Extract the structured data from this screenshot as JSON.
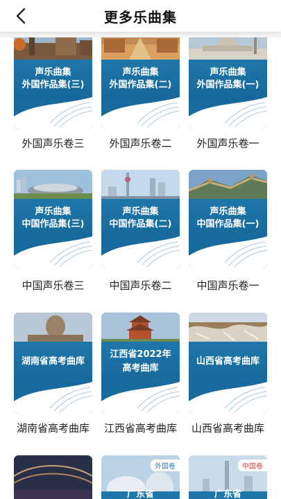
{
  "header": {
    "title": "更多乐曲集"
  },
  "cards": [
    {
      "cover_lines": [
        "声乐曲集",
        "外国作品集(三)"
      ],
      "label": "外国声乐卷三"
    },
    {
      "cover_lines": [
        "声乐曲集",
        "外国作品集(二)"
      ],
      "label": "外国声乐卷二"
    },
    {
      "cover_lines": [
        "声乐曲集",
        "外国作品集(一)"
      ],
      "label": "外国声乐卷一"
    },
    {
      "cover_lines": [
        "声乐曲集",
        "中国作品集(三)"
      ],
      "label": "中国声乐卷三"
    },
    {
      "cover_lines": [
        "声乐曲集",
        "中国作品集(二)"
      ],
      "label": "中国声乐卷二"
    },
    {
      "cover_lines": [
        "声乐曲集",
        "中国作品集(一)"
      ],
      "label": "中国声乐卷一"
    },
    {
      "cover_lines": [
        "湖南省高考曲库"
      ],
      "label": "湖南省高考曲库"
    },
    {
      "cover_lines": [
        "江西省2022年",
        "高考曲库"
      ],
      "label": "江西省高考曲库"
    },
    {
      "cover_lines": [
        "山西省高考曲库"
      ],
      "label": "山西省高考曲库"
    },
    {
      "cover_lines": [],
      "label": ""
    },
    {
      "cover_lines": [
        "广东省"
      ],
      "tag": "外国卷",
      "label": ""
    },
    {
      "cover_lines": [
        "广东省"
      ],
      "tag": "中国卷",
      "label": ""
    }
  ]
}
